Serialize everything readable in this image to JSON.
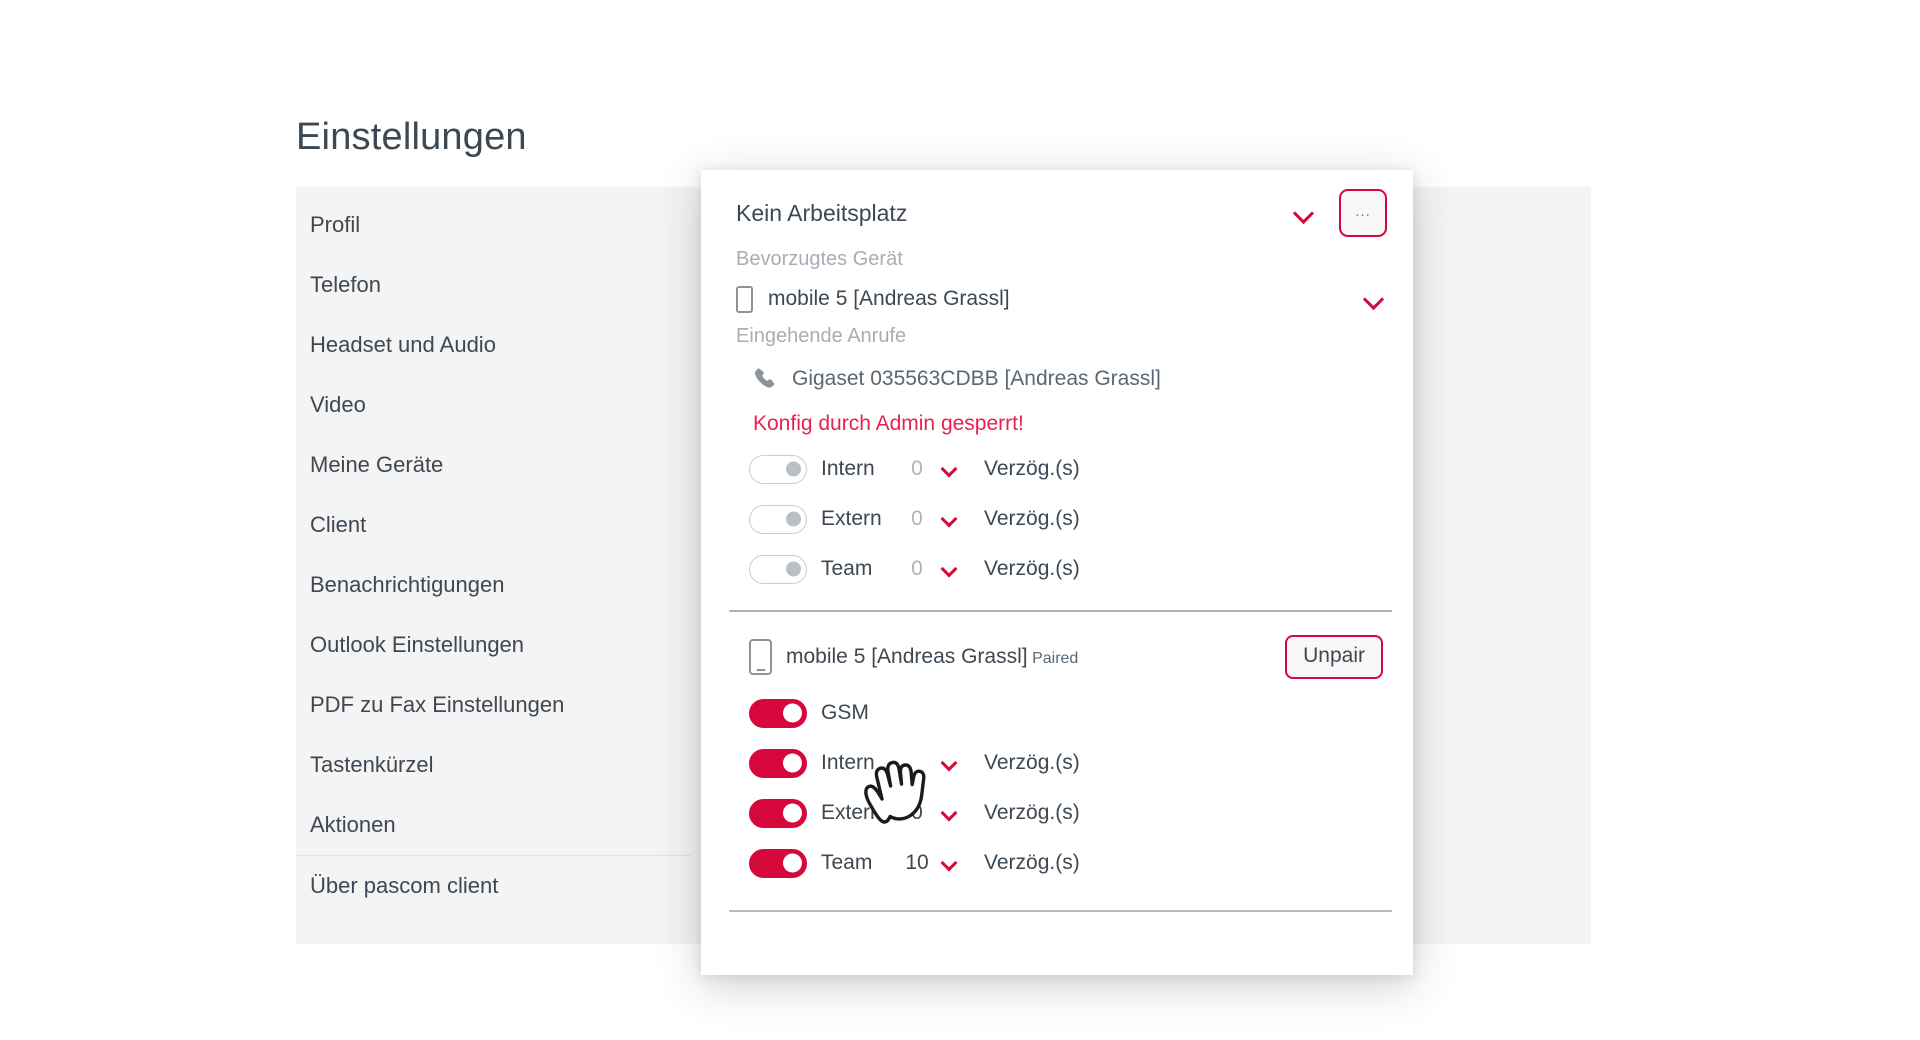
{
  "page": {
    "title": "Einstellungen"
  },
  "sidebar": {
    "items": [
      {
        "label": "Profil"
      },
      {
        "label": "Telefon"
      },
      {
        "label": "Headset und Audio"
      },
      {
        "label": "Video"
      },
      {
        "label": "Meine Geräte"
      },
      {
        "label": "Client"
      },
      {
        "label": "Benachrichtigungen"
      },
      {
        "label": "Outlook Einstellungen"
      },
      {
        "label": "PDF zu Fax Einstellungen"
      },
      {
        "label": "Tastenkürzel"
      },
      {
        "label": "Aktionen"
      },
      {
        "label": "Über pascom client"
      }
    ]
  },
  "modal": {
    "workspace": {
      "title": "Kein Arbeitsplatz",
      "chevron_icon": "chevron-down-icon",
      "more_label": "..."
    },
    "preferred_device": {
      "caption": "Bevorzugtes Gerät",
      "device_icon": "mobile-phone-icon",
      "device_name": "mobile 5 [Andreas Grassl]",
      "chevron_icon": "chevron-down-icon"
    },
    "incoming_calls": {
      "caption": "Eingehende Anrufe",
      "device_icon": "handset-phone-icon",
      "device_name": "Gigaset 035563CDBB [Andreas Grassl]",
      "locked_message": "Konfig durch Admin gesperrt!",
      "rows": [
        {
          "label": "Intern",
          "on": false,
          "delay": "0",
          "unit": "Verzög.(s)"
        },
        {
          "label": "Extern",
          "on": false,
          "delay": "0",
          "unit": "Verzög.(s)"
        },
        {
          "label": "Team",
          "on": false,
          "delay": "0",
          "unit": "Verzög.(s)"
        }
      ]
    },
    "paired_device": {
      "device_icon": "mobile-phone-icon",
      "device_name": "mobile 5 [Andreas Grassl]",
      "status": "Paired",
      "unpair_label": "Unpair",
      "rows": [
        {
          "label": "GSM",
          "on": true,
          "delay": "",
          "unit": ""
        },
        {
          "label": "Intern",
          "on": true,
          "delay": "",
          "unit": "Verzög.(s)"
        },
        {
          "label": "Extern",
          "on": true,
          "delay": "0",
          "unit": "Verzög.(s)"
        },
        {
          "label": "Team",
          "on": true,
          "delay": "10",
          "unit": "Verzög.(s)"
        }
      ]
    }
  },
  "colors": {
    "accent": "#d6083b",
    "warning_text": "#e8224e",
    "text": "#3d4852",
    "muted": "#a7adb5",
    "panel_bg": "#f4f4f5"
  },
  "cursor": {
    "icon": "hand-pointer-cursor"
  }
}
